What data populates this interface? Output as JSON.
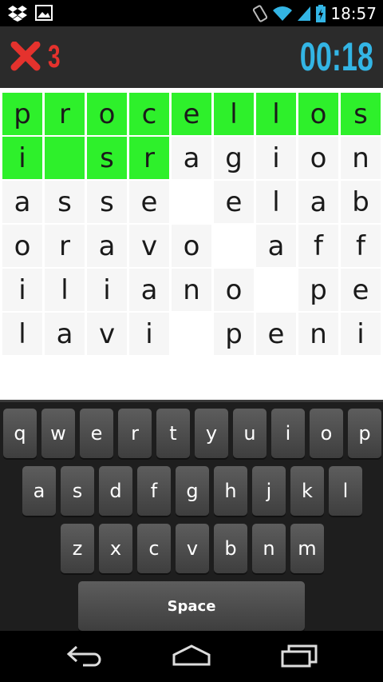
{
  "status_bar": {
    "time": "18:57",
    "icons": [
      "dropbox-icon",
      "image-icon",
      "rotate-icon",
      "wifi-icon",
      "signal-icon",
      "battery-charging-icon"
    ]
  },
  "header": {
    "error_icon": "close-icon",
    "error_count": "3",
    "timer": "00:18",
    "colors": {
      "error": "#e5322d",
      "timer": "#33b5e5",
      "background": "#2b2b2b"
    }
  },
  "grid": {
    "colors": {
      "highlight": "#2ef02b"
    },
    "rows": [
      [
        {
          "ch": "p",
          "state": "green"
        },
        {
          "ch": "r",
          "state": "green"
        },
        {
          "ch": "o",
          "state": "green"
        },
        {
          "ch": "c",
          "state": "green"
        },
        {
          "ch": "e",
          "state": "green"
        },
        {
          "ch": "l",
          "state": "green"
        },
        {
          "ch": "l",
          "state": "green"
        },
        {
          "ch": "o",
          "state": "green"
        },
        {
          "ch": "s",
          "state": "green"
        }
      ],
      [
        {
          "ch": "i",
          "state": "green"
        },
        {
          "ch": "",
          "state": "green"
        },
        {
          "ch": "s",
          "state": "green"
        },
        {
          "ch": "r",
          "state": "green"
        },
        {
          "ch": "a",
          "state": "plain"
        },
        {
          "ch": "g",
          "state": "plain"
        },
        {
          "ch": "i",
          "state": "plain"
        },
        {
          "ch": "o",
          "state": "plain"
        },
        {
          "ch": "n",
          "state": "plain"
        }
      ],
      [
        {
          "ch": "a",
          "state": "plain"
        },
        {
          "ch": "s",
          "state": "plain"
        },
        {
          "ch": "s",
          "state": "plain"
        },
        {
          "ch": "e",
          "state": "plain"
        },
        {
          "ch": "",
          "state": "plain"
        },
        {
          "ch": "e",
          "state": "plain"
        },
        {
          "ch": "l",
          "state": "plain"
        },
        {
          "ch": "a",
          "state": "plain"
        },
        {
          "ch": "b",
          "state": "plain"
        }
      ],
      [
        {
          "ch": "o",
          "state": "plain"
        },
        {
          "ch": "r",
          "state": "plain"
        },
        {
          "ch": "a",
          "state": "plain"
        },
        {
          "ch": "v",
          "state": "plain"
        },
        {
          "ch": "o",
          "state": "plain"
        },
        {
          "ch": "",
          "state": "plain"
        },
        {
          "ch": "a",
          "state": "plain"
        },
        {
          "ch": "f",
          "state": "plain"
        },
        {
          "ch": "f",
          "state": "plain"
        }
      ],
      [
        {
          "ch": "i",
          "state": "plain"
        },
        {
          "ch": "l",
          "state": "plain"
        },
        {
          "ch": "i",
          "state": "plain"
        },
        {
          "ch": "a",
          "state": "plain"
        },
        {
          "ch": "n",
          "state": "plain"
        },
        {
          "ch": "o",
          "state": "plain"
        },
        {
          "ch": "",
          "state": "plain"
        },
        {
          "ch": "p",
          "state": "plain"
        },
        {
          "ch": "e",
          "state": "plain"
        }
      ],
      [
        {
          "ch": "l",
          "state": "plain"
        },
        {
          "ch": "a",
          "state": "plain"
        },
        {
          "ch": "v",
          "state": "plain"
        },
        {
          "ch": "i",
          "state": "plain"
        },
        {
          "ch": "",
          "state": "plain"
        },
        {
          "ch": "p",
          "state": "plain"
        },
        {
          "ch": "e",
          "state": "plain"
        },
        {
          "ch": "n",
          "state": "plain"
        },
        {
          "ch": "i",
          "state": "plain"
        }
      ]
    ]
  },
  "keyboard": {
    "rows": [
      [
        "q",
        "w",
        "e",
        "r",
        "t",
        "y",
        "u",
        "i",
        "o",
        "p"
      ],
      [
        "a",
        "s",
        "d",
        "f",
        "g",
        "h",
        "j",
        "k",
        "l"
      ],
      [
        "z",
        "x",
        "c",
        "v",
        "b",
        "n",
        "m"
      ]
    ],
    "space_label": "Space"
  },
  "nav_bar": {
    "buttons": [
      "back-icon",
      "home-icon",
      "recent-apps-icon"
    ]
  }
}
